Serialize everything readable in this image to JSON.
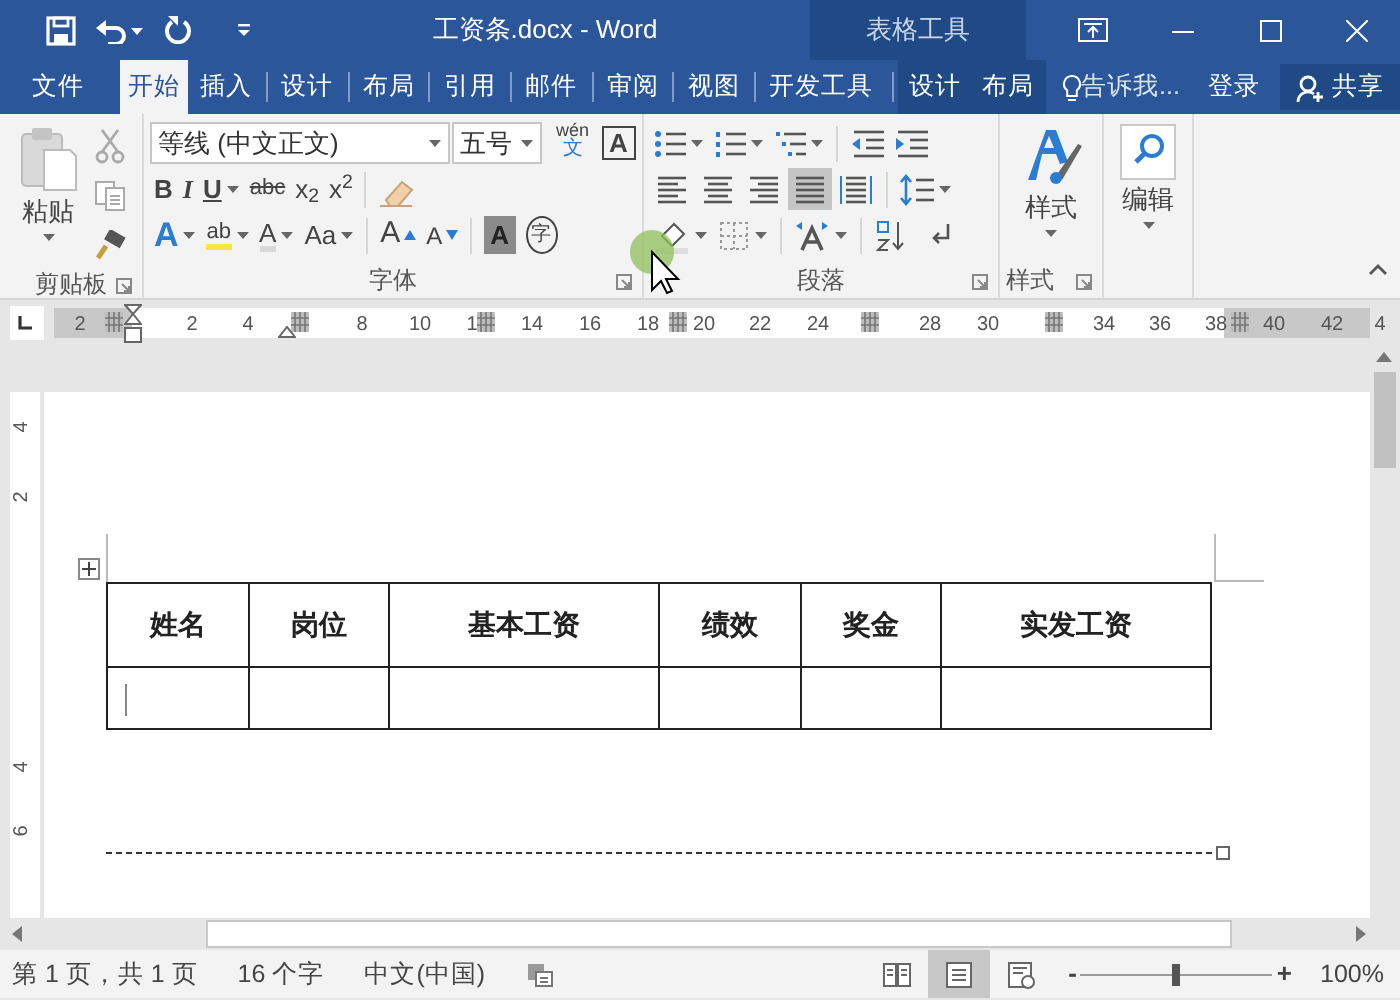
{
  "title_bar": {
    "title": "工资条.docx - Word",
    "context_label": "表格工具"
  },
  "tabs": [
    {
      "label": "文件",
      "kind": "file",
      "selected": false
    },
    {
      "label": "开始",
      "kind": "main",
      "selected": true
    },
    {
      "label": "插入",
      "kind": "main",
      "selected": false
    },
    {
      "label": "设计",
      "kind": "main",
      "selected": false
    },
    {
      "label": "布局",
      "kind": "main",
      "selected": false
    },
    {
      "label": "引用",
      "kind": "main",
      "selected": false
    },
    {
      "label": "邮件",
      "kind": "main",
      "selected": false
    },
    {
      "label": "审阅",
      "kind": "main",
      "selected": false
    },
    {
      "label": "视图",
      "kind": "main",
      "selected": false
    },
    {
      "label": "开发工具",
      "kind": "main",
      "selected": false
    },
    {
      "label": "设计",
      "kind": "context",
      "selected": false
    },
    {
      "label": "布局",
      "kind": "context",
      "selected": false
    }
  ],
  "tell_me": "告诉我...",
  "sign_in": "登录",
  "share": "共享",
  "clipboard": {
    "paste": "粘贴",
    "label": "剪贴板"
  },
  "font": {
    "name": "等线 (中文正文)",
    "size": "五号",
    "phonetic_top": "wén",
    "phonetic_bottom": "文",
    "border_char": "A",
    "label": "字体",
    "row2": [
      "B",
      "I",
      "U",
      "abc",
      "x$_{2}$",
      "x$^{2}$"
    ],
    "row3": [
      "A",
      "ab",
      "A",
      "Aa",
      "A",
      "A",
      "A",
      "字"
    ]
  },
  "paragraph": {
    "label": "段落",
    "alignments": [
      {
        "kind": "left",
        "selected": false
      },
      {
        "kind": "center",
        "selected": false
      },
      {
        "kind": "right",
        "selected": false
      },
      {
        "kind": "justify",
        "selected": true
      },
      {
        "kind": "distribute",
        "selected": false
      }
    ]
  },
  "styles": {
    "button": "样式",
    "label": "样式"
  },
  "editing": {
    "button": "编辑"
  },
  "ruler": {
    "labels": [
      "2",
      "2",
      "4",
      "8",
      "10",
      "1",
      "14",
      "16",
      "18",
      "20",
      "22",
      "24",
      "28",
      "30",
      "34",
      "36",
      "38",
      "40",
      "42",
      "4"
    ]
  },
  "vertical_ruler": {
    "labels": [
      "4",
      "2",
      "4",
      "6"
    ]
  },
  "table": {
    "columns": [
      "姓名",
      "岗位",
      "基本工资",
      "绩效",
      "奖金",
      "实发工资"
    ]
  },
  "status_bar": {
    "page": "第 1 页，共 1 页",
    "words": "16 个字",
    "language": "中文(中国)",
    "views": [
      {
        "kind": "read",
        "selected": false
      },
      {
        "kind": "print",
        "selected": true
      },
      {
        "kind": "web",
        "selected": false
      }
    ],
    "zoom_out": "-",
    "zoom_slider": {
      "level": 0.5
    },
    "zoom_in": "+",
    "zoom": "100%"
  }
}
